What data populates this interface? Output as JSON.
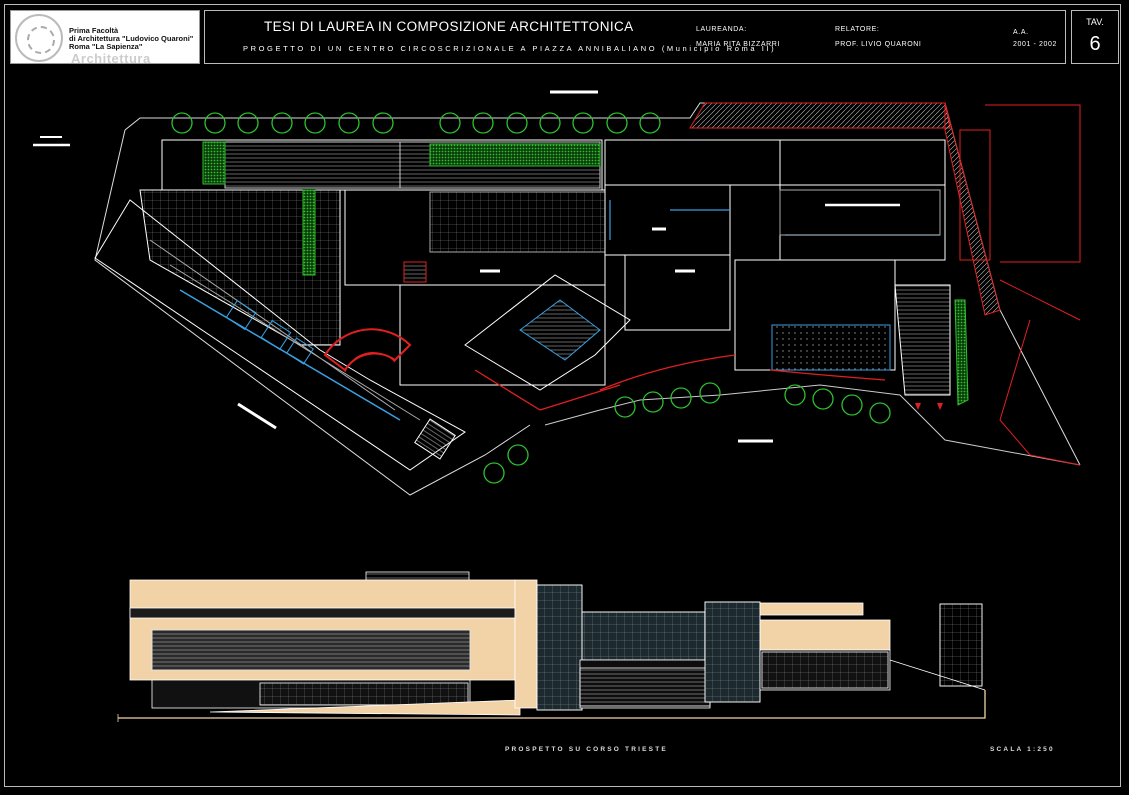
{
  "logo": {
    "line1": "Prima Facoltà",
    "line2": "di Architettura \"Ludovico Quaroni\"",
    "line3": "Roma \"La Sapienza\"",
    "wordmark": "Architettura"
  },
  "header": {
    "title": "TESI DI LAUREA IN COMPOSIZIONE ARCHITETTONICA",
    "subtitle": "PROGETTO DI UN CENTRO CIRCOSCRIZIONALE A PIAZZA ANNIBALIANO (Municipio Roma II)",
    "student_label": "LAUREANDA:",
    "student_name": "MARIA RITA BIZZARRI",
    "advisor_label": "RELATORE:",
    "advisor_name": "PROF. LIVIO QUARONI",
    "year_label": "A.A.",
    "year_value": "2001 - 2002",
    "tav_label": "TAV.",
    "tav_number": "6"
  },
  "footer": {
    "caption": "PROSPETTO SU CORSO TRIESTE",
    "scale": "SCALA 1:250"
  },
  "colors": {
    "background": "#000000",
    "linework": "#ffffff",
    "trees": "#2fbf2f",
    "wall_red": "#e02020",
    "glass_blue": "#3aa0e0",
    "facade_beige": "#f2d3a8",
    "hatch_green": "#2fbf2f"
  }
}
